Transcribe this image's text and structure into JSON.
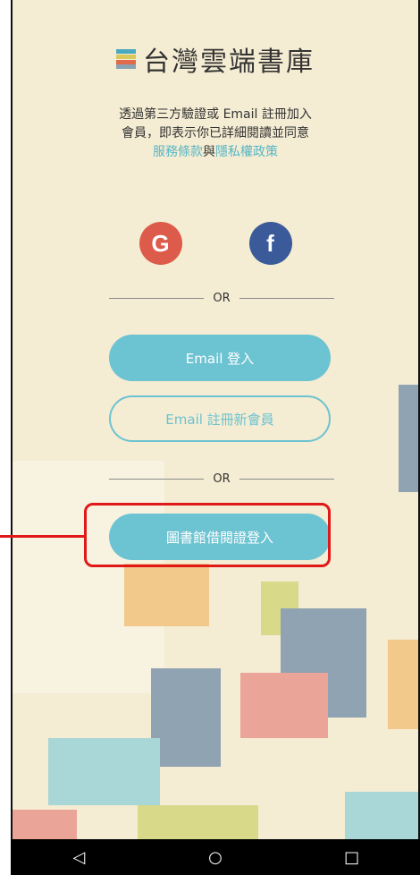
{
  "header": {
    "title": "台灣雲端書庫",
    "logo_colors": [
      "#4aa8c0",
      "#d9c85a",
      "#e06a4a",
      "#8aa2b3"
    ]
  },
  "notice": {
    "line1": "透過第三方驗證或 Email 註冊加入",
    "line2": "會員，即表示你已詳細閱讀並同意",
    "terms_link": "服務條款",
    "and_text": "與",
    "privacy_link": "隱私權政策"
  },
  "social": {
    "google_label": "G",
    "facebook_label": "f",
    "google_icon": "google-icon",
    "facebook_icon": "facebook-icon"
  },
  "dividers": {
    "or_text": "OR"
  },
  "buttons": {
    "email_login": "Email 登入",
    "email_register": "Email 註冊新會員",
    "library_login": "圖書館借閱證登入"
  },
  "navbar": {
    "back_icon": "◁",
    "home_icon": "○",
    "recents_icon": "□"
  },
  "colors": {
    "accent": "#6cc3d1",
    "background": "#f4ecd3",
    "highlight": "#e01818"
  }
}
